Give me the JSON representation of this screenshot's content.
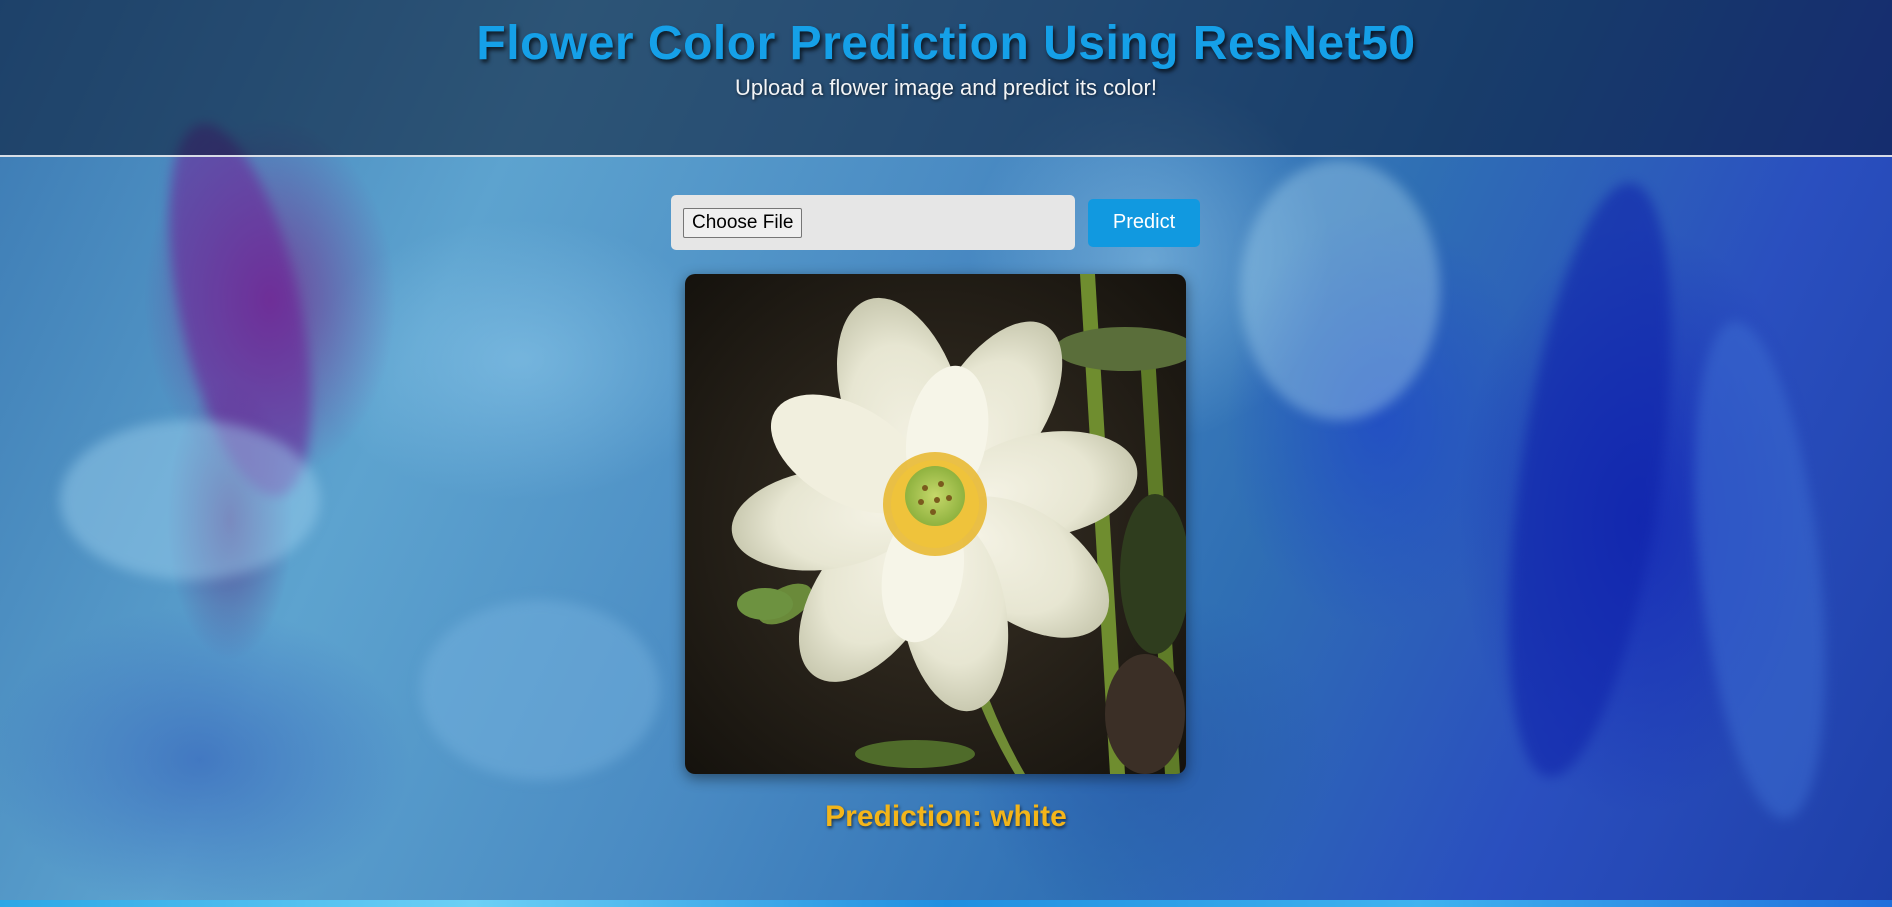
{
  "header": {
    "title": "Flower Color Prediction Using ResNet50",
    "subtitle": "Upload a flower image and predict its color!"
  },
  "upload": {
    "choose_file_label": "Choose File",
    "predict_label": "Predict"
  },
  "preview": {
    "image_subject": "white lotus flower"
  },
  "result": {
    "prediction_text": "Prediction: white"
  },
  "colors": {
    "title": "#15a0e8",
    "predict_button": "#1199e0",
    "prediction_text": "#f3b51a",
    "header_overlay": "rgba(5,20,45,0.55)"
  },
  "icons": {
    "preview_image": "flower-image"
  }
}
